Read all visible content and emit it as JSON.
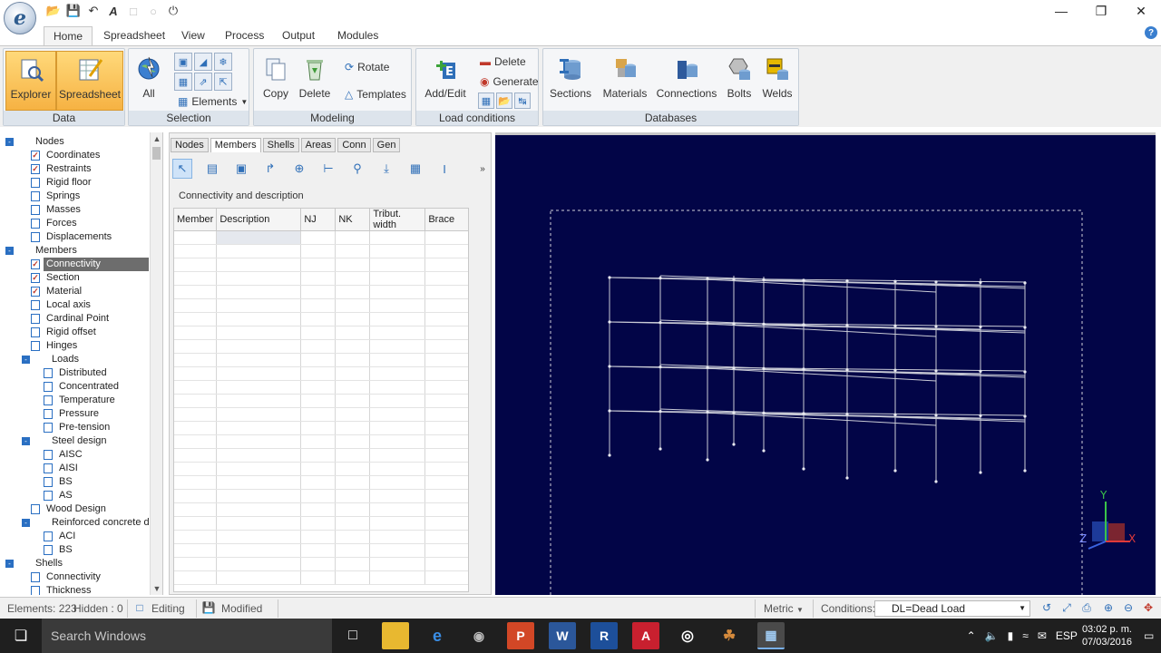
{
  "app": {
    "logo_letter": "e"
  },
  "ribbon_tabs": [
    "Home",
    "Spreadsheet",
    "View",
    "Process",
    "Output",
    "Modules"
  ],
  "ribbon": {
    "data": {
      "label": "Data",
      "explorer": "Explorer",
      "spreadsheet": "Spreadsheet"
    },
    "selection": {
      "label": "Selection",
      "all": "All",
      "elements": "Elements"
    },
    "modeling": {
      "label": "Modeling",
      "copy": "Copy",
      "delete": "Delete",
      "rotate": "Rotate",
      "templates": "Templates"
    },
    "load_conditions": {
      "label": "Load conditions",
      "add_edit": "Add/Edit",
      "delete": "Delete",
      "generate": "Generate"
    },
    "databases": {
      "label": "Databases",
      "sections": "Sections",
      "materials": "Materials",
      "connections": "Connections",
      "bolts": "Bolts",
      "welds": "Welds"
    }
  },
  "tree": [
    {
      "label": "Nodes",
      "level": 0,
      "type": "group"
    },
    {
      "label": "Coordinates",
      "level": 1,
      "type": "item",
      "checked": true
    },
    {
      "label": "Restraints",
      "level": 1,
      "type": "item",
      "checked": true
    },
    {
      "label": "Rigid floor",
      "level": 1,
      "type": "item",
      "checked": false
    },
    {
      "label": "Springs",
      "level": 1,
      "type": "item",
      "checked": false
    },
    {
      "label": "Masses",
      "level": 1,
      "type": "item",
      "checked": false
    },
    {
      "label": "Forces",
      "level": 1,
      "type": "item",
      "checked": false
    },
    {
      "label": "Displacements",
      "level": 1,
      "type": "item",
      "checked": false
    },
    {
      "label": "Members",
      "level": 0,
      "type": "group"
    },
    {
      "label": "Connectivity",
      "level": 1,
      "type": "item",
      "checked": true,
      "selected": true
    },
    {
      "label": "Section",
      "level": 1,
      "type": "item",
      "checked": true
    },
    {
      "label": "Material",
      "level": 1,
      "type": "item",
      "checked": true
    },
    {
      "label": "Local axis",
      "level": 1,
      "type": "item",
      "checked": false
    },
    {
      "label": "Cardinal Point",
      "level": 1,
      "type": "item",
      "checked": false
    },
    {
      "label": "Rigid offset",
      "level": 1,
      "type": "item",
      "checked": false
    },
    {
      "label": "Hinges",
      "level": 1,
      "type": "item",
      "checked": false
    },
    {
      "label": "Loads",
      "level": 1,
      "type": "group"
    },
    {
      "label": "Distributed",
      "level": 2,
      "type": "item",
      "checked": false
    },
    {
      "label": "Concentrated",
      "level": 2,
      "type": "item",
      "checked": false
    },
    {
      "label": "Temperature",
      "level": 2,
      "type": "item",
      "checked": false
    },
    {
      "label": "Pressure",
      "level": 2,
      "type": "item",
      "checked": false
    },
    {
      "label": "Pre-tension",
      "level": 2,
      "type": "item",
      "checked": false
    },
    {
      "label": "Steel design",
      "level": 1,
      "type": "group"
    },
    {
      "label": "AISC",
      "level": 2,
      "type": "item",
      "checked": false
    },
    {
      "label": "AISI",
      "level": 2,
      "type": "item",
      "checked": false
    },
    {
      "label": "BS",
      "level": 2,
      "type": "item",
      "checked": false
    },
    {
      "label": "AS",
      "level": 2,
      "type": "item",
      "checked": false
    },
    {
      "label": "Wood Design",
      "level": 1,
      "type": "item",
      "checked": false
    },
    {
      "label": "Reinforced concrete desi",
      "level": 1,
      "type": "group"
    },
    {
      "label": "ACI",
      "level": 2,
      "type": "item",
      "checked": false
    },
    {
      "label": "BS",
      "level": 2,
      "type": "item",
      "checked": false
    },
    {
      "label": "Shells",
      "level": 0,
      "type": "group"
    },
    {
      "label": "Connectivity",
      "level": 1,
      "type": "item",
      "checked": false
    },
    {
      "label": "Thickness",
      "level": 1,
      "type": "item",
      "checked": false
    }
  ],
  "sheet": {
    "tabs": [
      "Nodes",
      "Members",
      "Shells",
      "Areas",
      "Conn",
      "Gen"
    ],
    "active_tab": "Members",
    "caption": "Connectivity and description",
    "columns": [
      "Member",
      "Description",
      "NJ",
      "NK",
      "Tribut. width",
      "Brace"
    ]
  },
  "viewport": {
    "axis_labels": {
      "x": "X",
      "y": "Y",
      "z": "Z"
    },
    "colors": {
      "background": "#020547",
      "frame": "#c9cbd6"
    }
  },
  "status": {
    "elements": "Elements: 223",
    "hidden": "Hidden : 0",
    "editing": "Editing",
    "modified": "Modified",
    "units": "Metric",
    "conditions_label": "Conditions:",
    "condition_value": "DL=Dead Load"
  },
  "taskbar": {
    "search": "Search Windows",
    "apps": [
      "folder",
      "edge",
      "steam",
      "powerpoint",
      "word",
      "revit",
      "autocad",
      "media",
      "gimp",
      "app"
    ],
    "lang": "ESP",
    "time": "03:02 p. m.",
    "date": "07/03/2016"
  }
}
